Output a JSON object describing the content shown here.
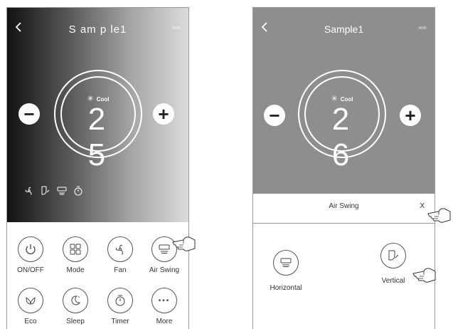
{
  "screen1": {
    "title": "S am p le1",
    "more": "◦◦◦",
    "mode_label": "Cool",
    "temperature": "2 5",
    "minus": "−",
    "plus": "+",
    "buttons": [
      {
        "label": "ON/OFF",
        "icon": "power-icon"
      },
      {
        "label": "Mode",
        "icon": "mode-grid-icon"
      },
      {
        "label": "Fan",
        "icon": "fan-icon"
      },
      {
        "label": "Air Swing",
        "icon": "air-swing-icon"
      },
      {
        "label": "Eco",
        "icon": "eco-leaf-icon"
      },
      {
        "label": "Sleep",
        "icon": "sleep-moon-icon"
      },
      {
        "label": "Timer",
        "icon": "timer-icon"
      },
      {
        "label": "More",
        "icon": "more-dots-icon"
      }
    ],
    "more_dots": "•••"
  },
  "screen2": {
    "title": "Sample1",
    "more": "◦◦◦",
    "mode_label": "Cool",
    "temperature": "2 6",
    "minus": "−",
    "plus": "+",
    "swing_title": "Air Swing",
    "close": "X",
    "options": [
      {
        "label": "Horizontal",
        "icon": "horizontal-swing-icon"
      },
      {
        "label": "Vertical",
        "icon": "vertical-swing-icon"
      }
    ]
  },
  "colors": {
    "screen1_gradient_start": "#111111",
    "screen1_gradient_end": "#dcdcdc",
    "screen2_bg": "#8e8e8e"
  }
}
